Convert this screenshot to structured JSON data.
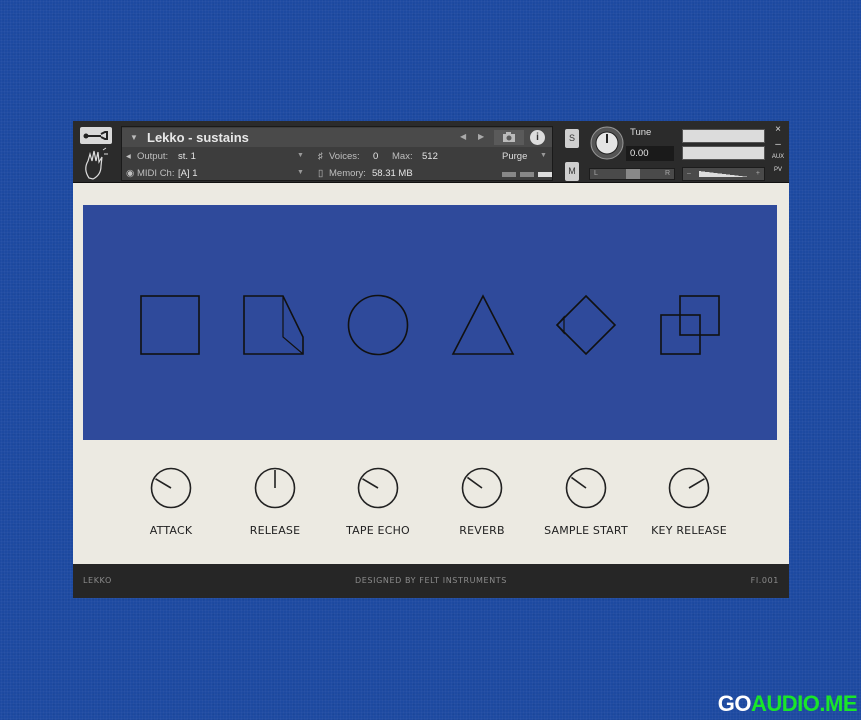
{
  "header": {
    "instrument_title": "Lekko - sustains",
    "output_label": "Output:",
    "output_value": "st. 1",
    "voices_label": "Voices:",
    "voices_value": "0",
    "max_label": "Max:",
    "max_value": "512",
    "midi_label": "MIDI Ch:",
    "midi_value": "[A]  1",
    "memory_label": "Memory:",
    "memory_value": "58.31 MB",
    "purge_label": "Purge",
    "solo_label": "S",
    "mute_label": "M",
    "tune_label": "Tune",
    "tune_value": "0.00",
    "pan_left": "L",
    "pan_right": "R",
    "aux_label": "AUX",
    "pv_label": "PV",
    "close_label": "×",
    "minimize_label": "–"
  },
  "shapes": [
    "square-icon",
    "trapezoid-icon",
    "circle-icon",
    "triangle-icon",
    "diamond-icon",
    "overlapping-squares-icon"
  ],
  "knobs": [
    {
      "label": "ATTACK",
      "level": 0.28
    },
    {
      "label": "RELEASE",
      "level": 0.5
    },
    {
      "label": "TAPE ECHO",
      "level": 0.28
    },
    {
      "label": "REVERB",
      "level": 0.3
    },
    {
      "label": "SAMPLE START",
      "level": 0.3
    },
    {
      "label": "KEY RELEASE",
      "level": 0.72
    }
  ],
  "footer": {
    "left": "LEKKO",
    "center": "DESIGNED BY FELT INSTRUMENTS",
    "right": "FI.001"
  },
  "colors": {
    "background": "#1d4aa1",
    "panel": "#2f4a9b",
    "body": "#eceae2",
    "header": "#2b2b2b"
  },
  "watermark": {
    "prefix": "GO",
    "accent": "AUDIO.ME"
  }
}
